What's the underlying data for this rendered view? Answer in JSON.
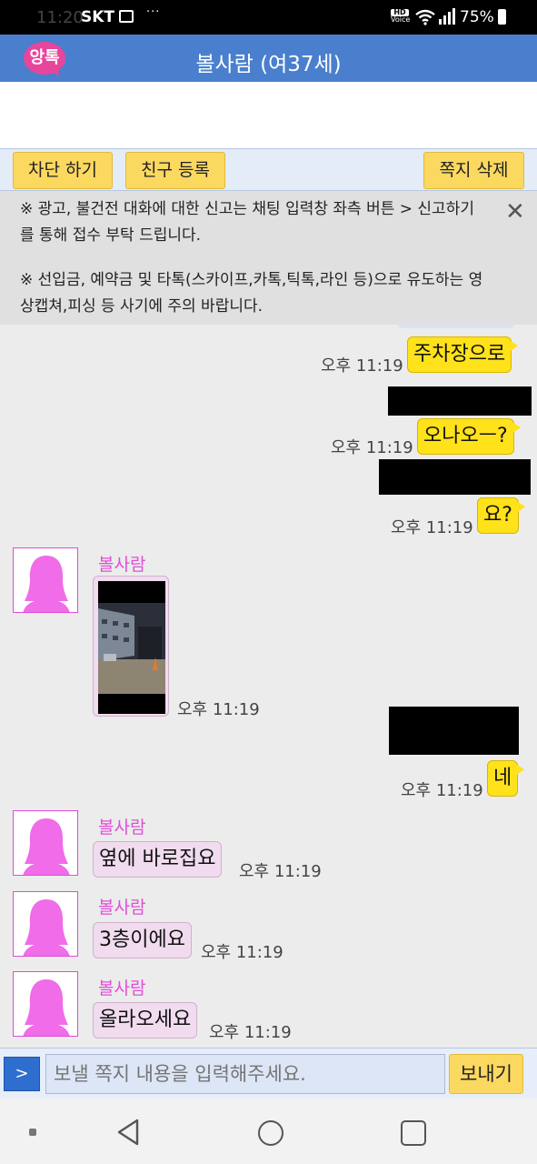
{
  "status_bar": {
    "time": "11:20",
    "carrier": "SKT",
    "hd_label": "HD",
    "voice_label": "Voice",
    "battery": "75%",
    "more": "···"
  },
  "header": {
    "logo_text": "앙톡",
    "title": "볼사람 (여37세)"
  },
  "actions": {
    "block": "차단 하기",
    "add_friend": "친구 등록",
    "delete_note": "쪽지 삭제"
  },
  "notice": {
    "line1": "※ 광고, 불건전 대화에 대한 신고는 채팅 입력창 좌측 버튼 > 신고하기를 통해 접수 부탁 드립니다.",
    "line2": "※ 선입금, 예약금 및 타톡(스카이프,카톡,틱톡,라인 등)으로 유도하는 영상캡쳐,피싱 등 사기에 주의 바랍니다.",
    "close_icon": "close-icon"
  },
  "messages": {
    "m1": {
      "text": "주차장으로",
      "time": "오후 11:19"
    },
    "m2": {
      "text": "오나오ㅡ?",
      "time": "오후 11:19"
    },
    "m3": {
      "text": "요?",
      "time": "오후 11:19"
    },
    "m4": {
      "sender": "볼사람",
      "time": "오후 11:19"
    },
    "m5": {
      "text": "네",
      "time": "오후 11:19"
    },
    "m6": {
      "sender": "볼사람",
      "text": "옆에 바로집요",
      "time": "오후 11:19"
    },
    "m7": {
      "sender": "볼사람",
      "text": "3층이에요",
      "time": "오후 11:19"
    },
    "m8": {
      "sender": "볼사람",
      "text": "올라오세요",
      "time": "오후 11:19"
    }
  },
  "input": {
    "arrow": ">",
    "placeholder": "보낼 쪽지 내용을 입력해주세요.",
    "send": "보내기"
  },
  "colors": {
    "header_blue": "#4a7fce",
    "my_bubble": "#ffe21a",
    "their_bubble": "#f1dcef",
    "sender_name": "#e04fd6",
    "button_yellow": "#fbd860"
  }
}
